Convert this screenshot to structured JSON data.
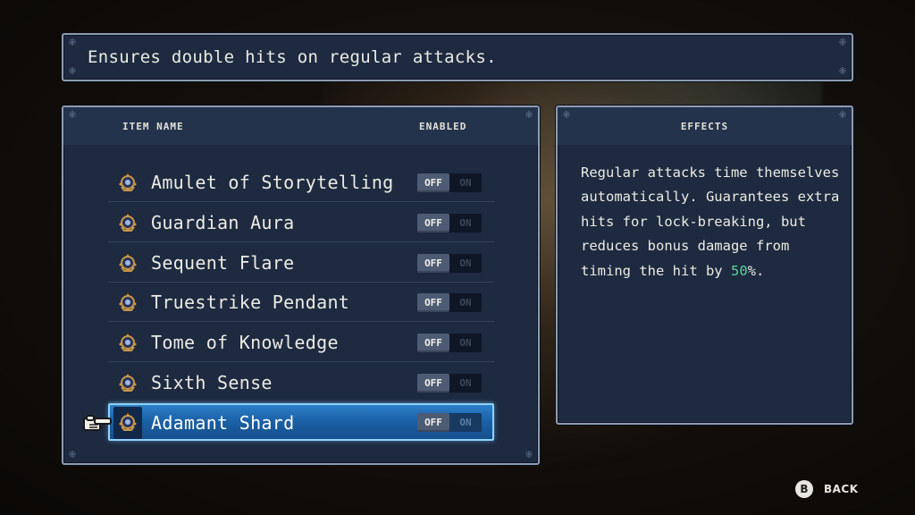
{
  "description": "Ensures double hits on regular attacks.",
  "list": {
    "header_name": "ITEM NAME",
    "header_enabled": "ENABLED",
    "items": [
      {
        "name": "Amulet of Storytelling",
        "off": "OFF",
        "on": "ON",
        "state": "off"
      },
      {
        "name": "Guardian Aura",
        "off": "OFF",
        "on": "ON",
        "state": "off"
      },
      {
        "name": "Sequent Flare",
        "off": "OFF",
        "on": "ON",
        "state": "off"
      },
      {
        "name": "Truestrike Pendant",
        "off": "OFF",
        "on": "ON",
        "state": "off"
      },
      {
        "name": "Tome of Knowledge",
        "off": "OFF",
        "on": "ON",
        "state": "off"
      },
      {
        "name": "Sixth Sense",
        "off": "OFF",
        "on": "ON",
        "state": "off"
      },
      {
        "name": "Adamant Shard",
        "off": "OFF",
        "on": "ON",
        "state": "off",
        "selected": true
      }
    ]
  },
  "effects": {
    "title": "EFFECTS",
    "text_before": "Regular attacks time themselves automatically. Guarantees extra hits for lock-breaking, but reduces bonus damage from timing the hit by ",
    "highlight": "50",
    "text_after": "%."
  },
  "footer": {
    "back_button": "B",
    "back_label": "BACK"
  },
  "colors": {
    "panel": "#1d2a40",
    "selected_row": "#1a5fa5",
    "highlight": "#5fd39a"
  },
  "icons": {
    "item": "relic-amulet-icon",
    "pointer": "pointing-hand-icon"
  }
}
